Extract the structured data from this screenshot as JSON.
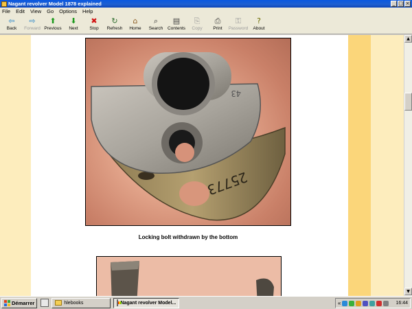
{
  "window": {
    "title": "Nagant revolver Model 1878 explained",
    "minimize": "_",
    "maximize": "□",
    "close": "×"
  },
  "menu": [
    "File",
    "Edit",
    "View",
    "Go",
    "Options",
    "Help"
  ],
  "toolbar": [
    {
      "label": "Back",
      "icon": "back-arrow-icon",
      "glyph": "⇦",
      "color": "#1a7ec8",
      "enabled": true
    },
    {
      "label": "Forward",
      "icon": "forward-arrow-icon",
      "glyph": "⇨",
      "color": "#1a7ec8",
      "enabled": false
    },
    {
      "label": "Previous",
      "icon": "up-arrow-icon",
      "glyph": "⬆",
      "color": "#1d9a1d",
      "enabled": true
    },
    {
      "label": "Next",
      "icon": "down-arrow-icon",
      "glyph": "⬇",
      "color": "#1d9a1d",
      "enabled": true
    },
    {
      "label": "Stop",
      "icon": "stop-icon",
      "glyph": "✖",
      "color": "#d01010",
      "enabled": true
    },
    {
      "label": "Refresh",
      "icon": "refresh-icon",
      "glyph": "↻",
      "color": "#2a6a2a",
      "enabled": true
    },
    {
      "label": "Home",
      "icon": "home-icon",
      "glyph": "⌂",
      "color": "#8a5a20",
      "enabled": true
    },
    {
      "label": "Search",
      "icon": "search-icon",
      "glyph": "⌕",
      "color": "#333333",
      "enabled": true
    },
    {
      "label": "Contents",
      "icon": "contents-icon",
      "glyph": "▤",
      "color": "#444444",
      "enabled": true
    },
    {
      "label": "Copy",
      "icon": "copy-icon",
      "glyph": "⎘",
      "color": "#9a9a9a",
      "enabled": false
    },
    {
      "label": "Print",
      "icon": "print-icon",
      "glyph": "⎙",
      "color": "#444444",
      "enabled": true
    },
    {
      "label": "Password",
      "icon": "key-icon",
      "glyph": "⚿",
      "color": "#9a9a9a",
      "enabled": false
    },
    {
      "label": "About",
      "icon": "about-icon",
      "glyph": "?",
      "color": "#6a6a00",
      "enabled": true
    }
  ],
  "content": {
    "caption": "Locking bolt withdrawn by the bottom",
    "engraving": "25773"
  },
  "taskbar": {
    "start_label": "Démarrer",
    "items": [
      {
        "label": "hlebooks",
        "active": false
      },
      {
        "label": "Nagant revolver Model...",
        "active": true
      }
    ],
    "tray_expand": "«",
    "clock": "16:44"
  },
  "colors": {
    "stripe_light": "#fdedbd",
    "stripe_gold": "#fbd67a",
    "title_blue": "#0a58e0"
  }
}
